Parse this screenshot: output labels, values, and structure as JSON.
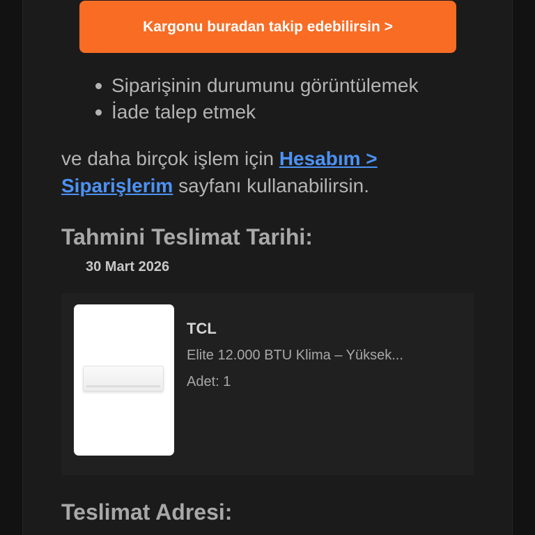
{
  "cta": {
    "label": "Kargonu buradan takip edebilirsin >"
  },
  "bullets": [
    "Siparişinin durumunu görüntülemek",
    "İade talep etmek"
  ],
  "paragraph": {
    "prefix": "ve daha birçok işlem için ",
    "link_label": "Hesabım > Siparişlerim",
    "suffix": " sayfanı kullanabilirsin."
  },
  "delivery": {
    "heading": "Tahmini Teslimat Tarihi:",
    "date": "30 Mart 2026"
  },
  "product": {
    "brand": "TCL",
    "name": "Elite 12.000 BTU Klima – Yüksek...",
    "quantity": "Adet: 1",
    "image_icon": "air-conditioner-icon"
  },
  "address": {
    "heading": "Teslimat Adresi:"
  },
  "colors": {
    "accent": "#f86c24",
    "link": "#4c92f5",
    "background": "#1b1b1b",
    "card": "#202020"
  }
}
